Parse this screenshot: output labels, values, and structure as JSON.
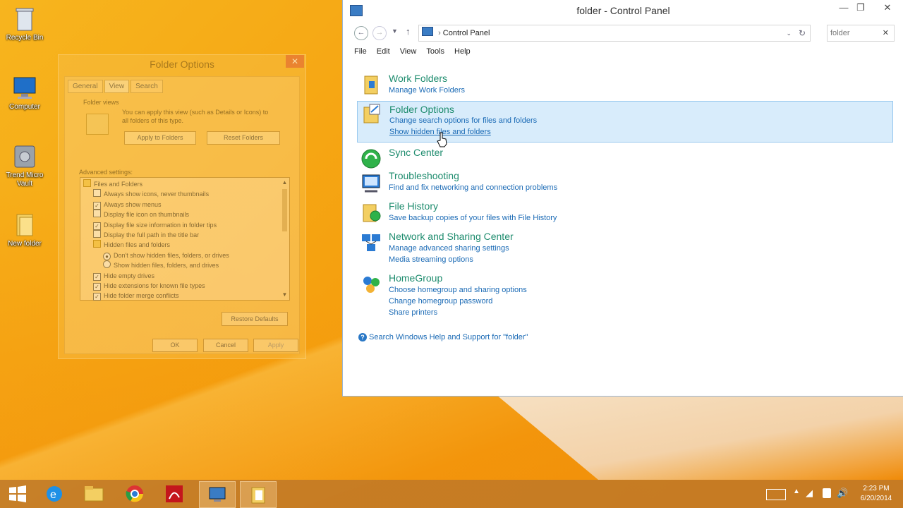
{
  "desktop": {
    "icons": [
      {
        "label": "Recycle Bin",
        "icon": "recycle-bin-icon"
      },
      {
        "label": "Computer",
        "icon": "computer-icon"
      },
      {
        "label": "Trend Micro Vault",
        "icon": "vault-icon"
      },
      {
        "label": "New folder",
        "icon": "folder-icon"
      }
    ]
  },
  "folder_options": {
    "title": "Folder Options",
    "close": "✕",
    "tabs": [
      "General",
      "View",
      "Search"
    ],
    "folder_views_heading": "Folder views",
    "folder_views_text_1": "You can apply this view (such as Details or Icons) to",
    "folder_views_text_2": "all folders of this type.",
    "apply_to_folders": "Apply to Folders",
    "reset_folders": "Reset Folders",
    "advanced_heading": "Advanced settings:",
    "advanced_rows": [
      {
        "text": "Files and Folders",
        "kind": "folder"
      },
      {
        "text": "Always show icons, never thumbnails",
        "kind": "check",
        "checked": false
      },
      {
        "text": "Always show menus",
        "kind": "check",
        "checked": true
      },
      {
        "text": "Display file icon on thumbnails",
        "kind": "check",
        "checked": false
      },
      {
        "text": "Display file size information in folder tips",
        "kind": "check",
        "checked": true
      },
      {
        "text": "Display the full path in the title bar",
        "kind": "check",
        "checked": false
      },
      {
        "text": "Hidden files and folders",
        "kind": "folder"
      },
      {
        "text": "Don't show hidden files, folders, or drives",
        "kind": "radio",
        "checked": true
      },
      {
        "text": "Show hidden files, folders, and drives",
        "kind": "radio",
        "checked": false
      },
      {
        "text": "Hide empty drives",
        "kind": "check",
        "checked": true
      },
      {
        "text": "Hide extensions for known file types",
        "kind": "check",
        "checked": true
      },
      {
        "text": "Hide folder merge conflicts",
        "kind": "check",
        "checked": true
      }
    ],
    "restore_defaults": "Restore Defaults",
    "ok": "OK",
    "cancel": "Cancel",
    "apply": "Apply"
  },
  "control_panel": {
    "title": "folder - Control Panel",
    "address": "Control Panel",
    "search_value": "folder",
    "menus": [
      "File",
      "Edit",
      "View",
      "Tools",
      "Help"
    ],
    "items": [
      {
        "heading": "Work Folders",
        "links": [
          "Manage Work Folders"
        ],
        "icon": "work-folders-icon"
      },
      {
        "heading": "Folder Options",
        "links": [
          "Change search options for files and folders",
          "Show hidden files and folders"
        ],
        "icon": "folder-options-icon"
      },
      {
        "heading": "Sync Center",
        "links": [],
        "icon": "sync-center-icon"
      },
      {
        "heading": "Troubleshooting",
        "links": [
          "Find and fix networking and connection problems"
        ],
        "icon": "troubleshooting-icon"
      },
      {
        "heading": "File History",
        "links": [
          "Save backup copies of your files with File History"
        ],
        "icon": "file-history-icon"
      },
      {
        "heading": "Network and Sharing Center",
        "links": [
          "Manage advanced sharing settings",
          "Media streaming options"
        ],
        "icon": "network-icon"
      },
      {
        "heading": "HomeGroup",
        "links": [
          "Choose homegroup and sharing options",
          "Change homegroup password",
          "Share printers"
        ],
        "icon": "homegroup-icon"
      }
    ],
    "help_text": "Search Windows Help and Support for \"folder\""
  },
  "taskbar": {
    "apps": [
      "start-icon",
      "internet-explorer-icon",
      "file-explorer-icon",
      "chrome-icon",
      "acrobat-icon",
      "control-panel-icon",
      "folder-options-icon"
    ],
    "time": "2:23 PM",
    "date": "6/20/2014"
  }
}
